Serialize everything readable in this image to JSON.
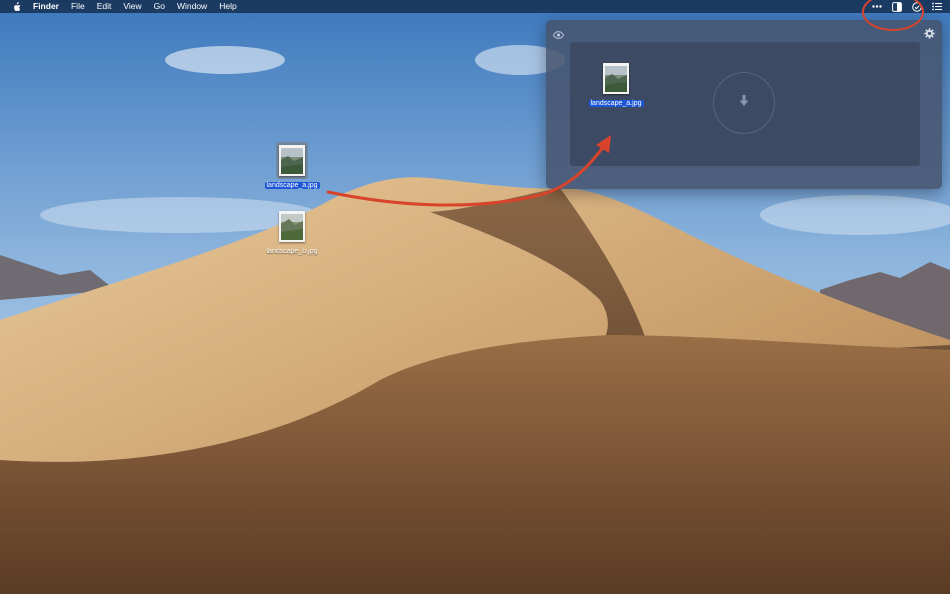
{
  "menubar": {
    "apple_icon": "apple-icon",
    "app_name": "Finder",
    "items": [
      "File",
      "Edit",
      "View",
      "Go",
      "Window",
      "Help"
    ],
    "status_icons": [
      "more-dots-icon",
      "sidebar-toggle-icon",
      "clock-icon",
      "list-icon"
    ]
  },
  "desktop": {
    "files": [
      {
        "name": "landscape_a.jpg",
        "selected": true
      },
      {
        "name": "landscape_b.jpg",
        "selected": false
      }
    ]
  },
  "shelf_panel": {
    "eye_icon": "eye-icon",
    "settings_icon": "gear-icon",
    "drop_target_icon": "download-arrow-icon",
    "files": [
      {
        "name": "landscape_a.jpg",
        "selected": true
      }
    ]
  },
  "colors": {
    "selection": "#1d56d6",
    "annotation": "#d8432b",
    "panel": "#46546e",
    "dropzone": "#3d4a63"
  }
}
